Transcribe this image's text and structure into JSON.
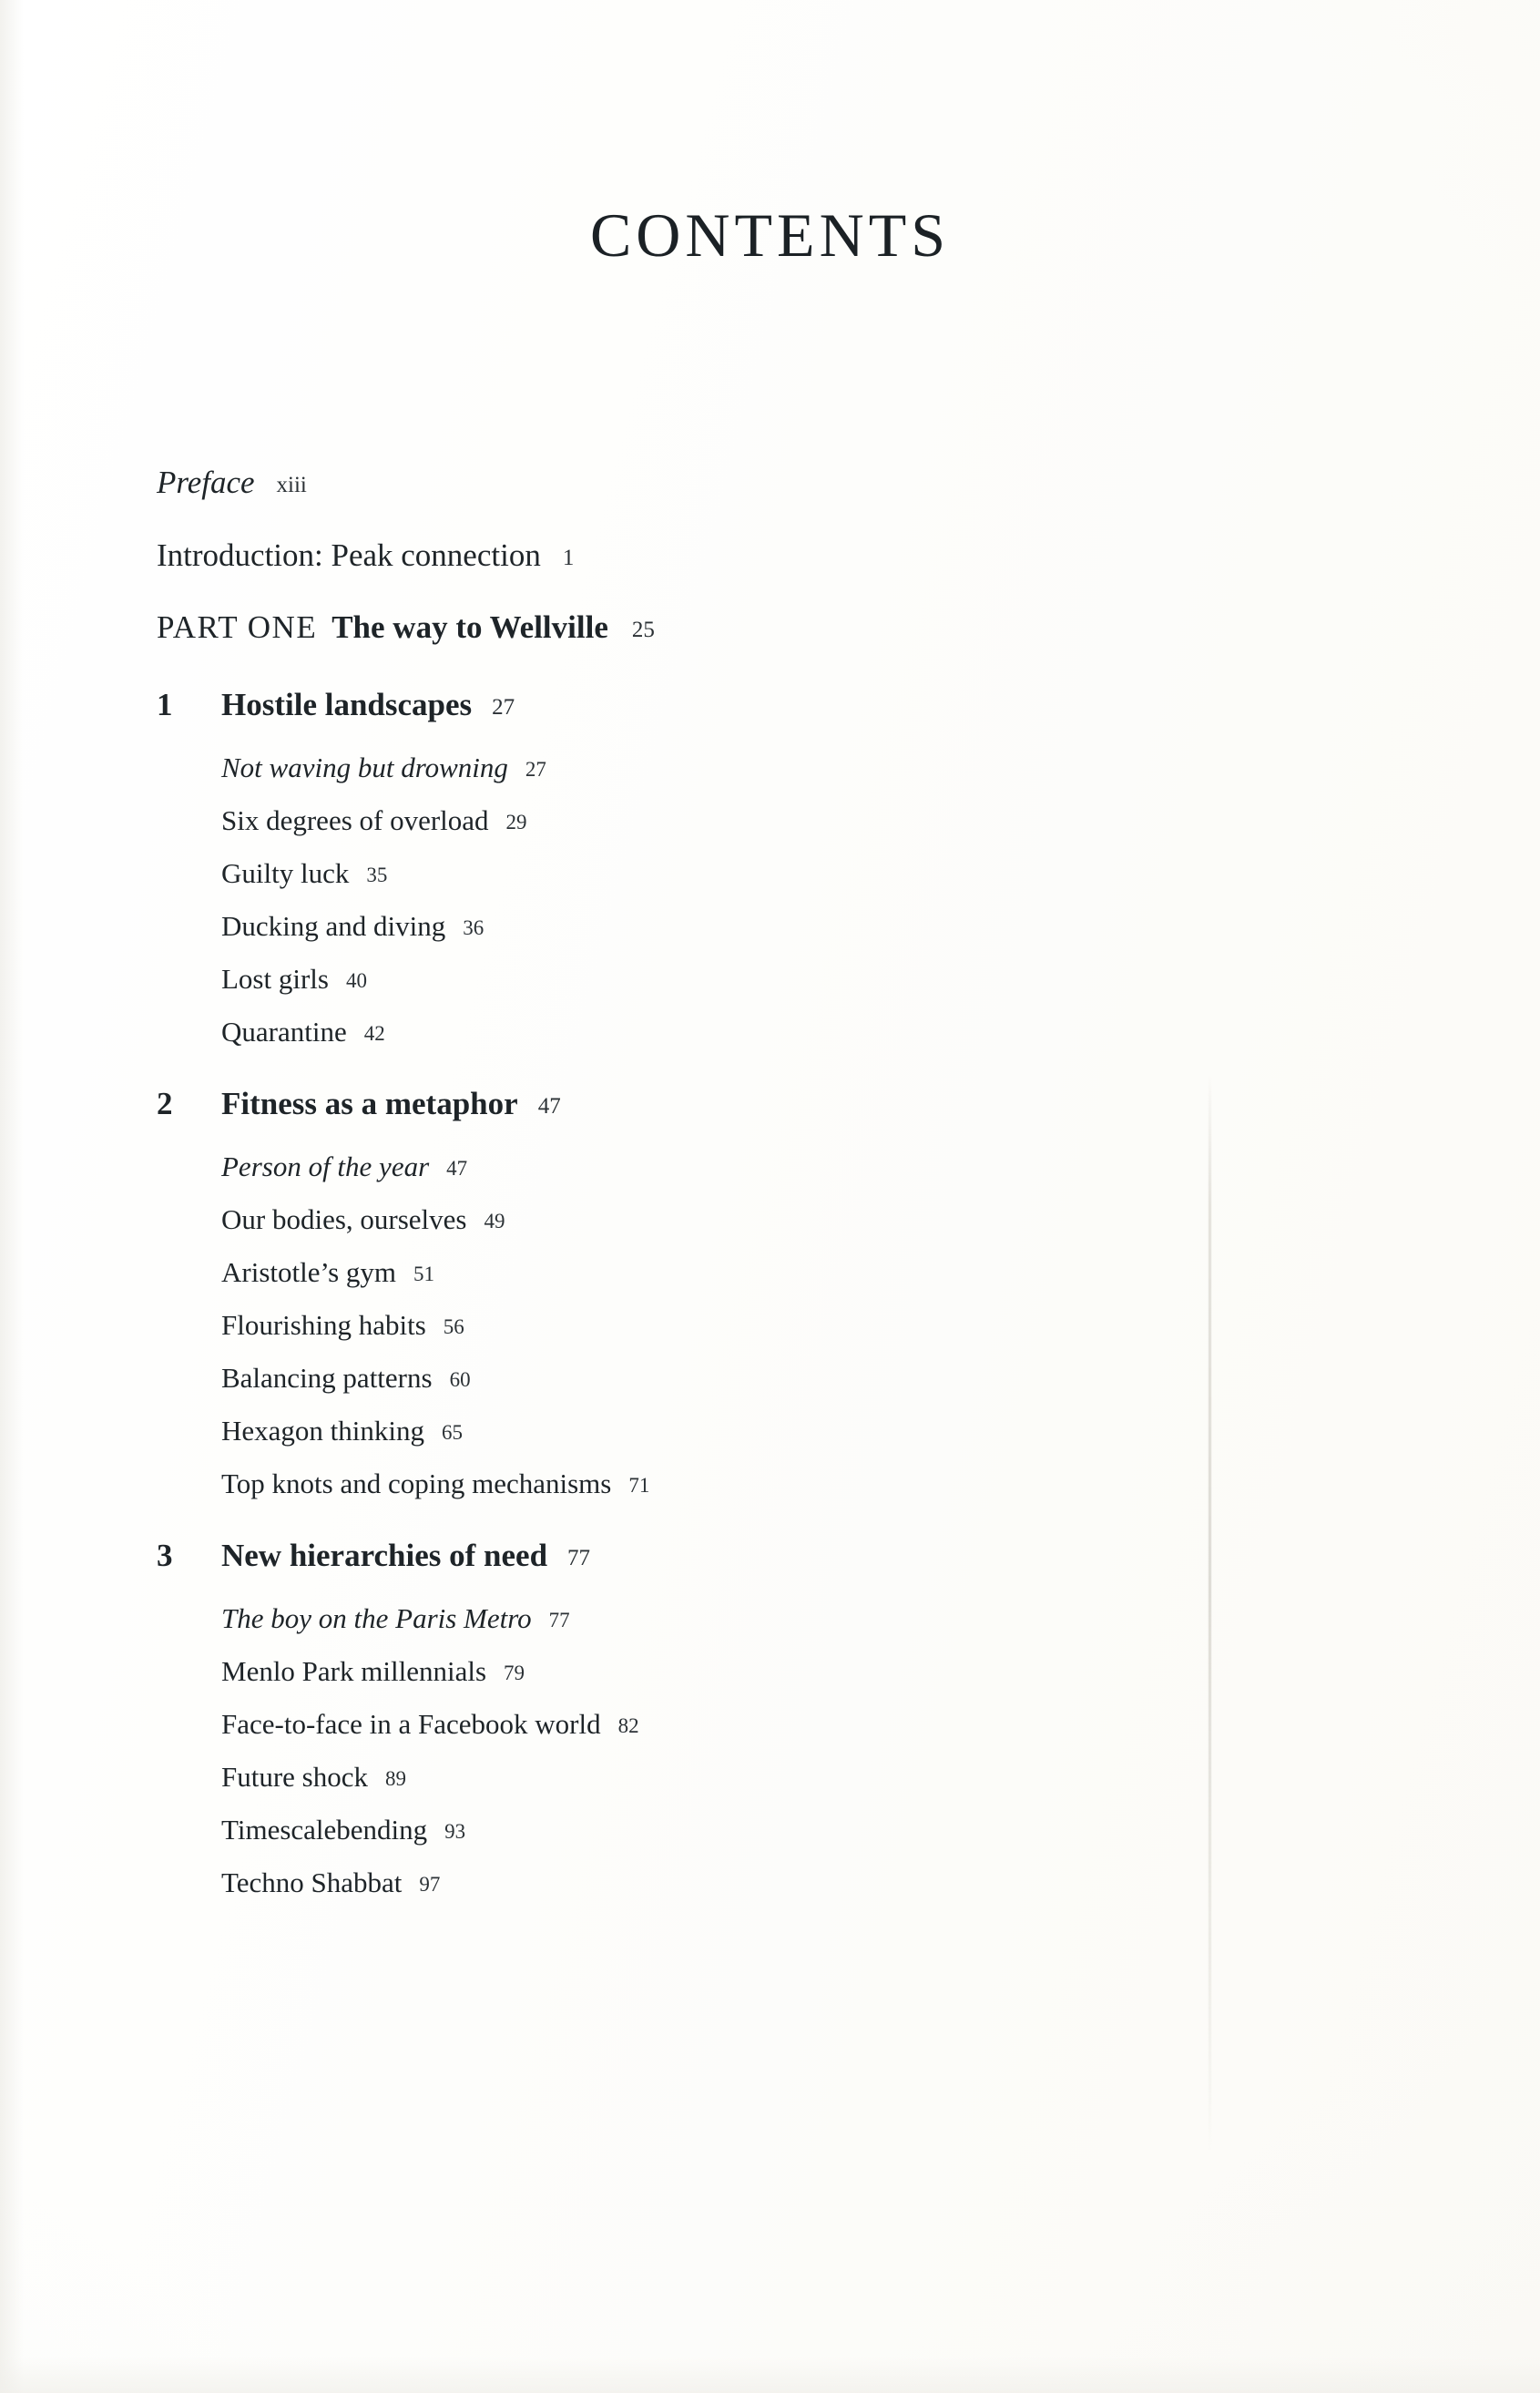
{
  "page": {
    "title": "CONTENTS"
  },
  "front_matter": [
    {
      "label": "Preface",
      "page": "xiii",
      "style": "italic"
    },
    {
      "label": "Introduction: Peak connection",
      "page": "1",
      "style": "roman"
    }
  ],
  "part": {
    "label": "PART ONE",
    "title": "The way to Wellville",
    "page": "25"
  },
  "chapters": [
    {
      "number": "1",
      "title": "Hostile landscapes",
      "page": "27",
      "sections": [
        {
          "label": "Not waving but drowning",
          "page": "27",
          "style": "italic"
        },
        {
          "label": "Six degrees of overload",
          "page": "29",
          "style": "roman"
        },
        {
          "label": "Guilty luck",
          "page": "35",
          "style": "roman"
        },
        {
          "label": "Ducking and diving",
          "page": "36",
          "style": "roman"
        },
        {
          "label": "Lost girls",
          "page": "40",
          "style": "roman"
        },
        {
          "label": "Quarantine",
          "page": "42",
          "style": "roman"
        }
      ]
    },
    {
      "number": "2",
      "title": "Fitness as a metaphor",
      "page": "47",
      "sections": [
        {
          "label": "Person of the year",
          "page": "47",
          "style": "italic"
        },
        {
          "label": "Our bodies, ourselves",
          "page": "49",
          "style": "roman"
        },
        {
          "label": "Aristotle’s gym",
          "page": "51",
          "style": "roman"
        },
        {
          "label": "Flourishing habits",
          "page": "56",
          "style": "roman"
        },
        {
          "label": "Balancing patterns",
          "page": "60",
          "style": "roman"
        },
        {
          "label": "Hexagon thinking",
          "page": "65",
          "style": "roman"
        },
        {
          "label": "Top knots and coping mechanisms",
          "page": "71",
          "style": "roman"
        }
      ]
    },
    {
      "number": "3",
      "title": "New hierarchies of need",
      "page": "77",
      "sections": [
        {
          "label": "The boy on the Paris Metro",
          "page": "77",
          "style": "italic"
        },
        {
          "label": "Menlo Park millennials",
          "page": "79",
          "style": "roman"
        },
        {
          "label": "Face-to-face in a Facebook world",
          "page": "82",
          "style": "roman"
        },
        {
          "label": "Future shock",
          "page": "89",
          "style": "roman"
        },
        {
          "label": "Timescalebending",
          "page": "93",
          "style": "roman"
        },
        {
          "label": "Techno Shabbat",
          "page": "97",
          "style": "roman"
        }
      ]
    }
  ],
  "colors": {
    "ink": "#1e2428",
    "paper": "#fdfdfc"
  }
}
